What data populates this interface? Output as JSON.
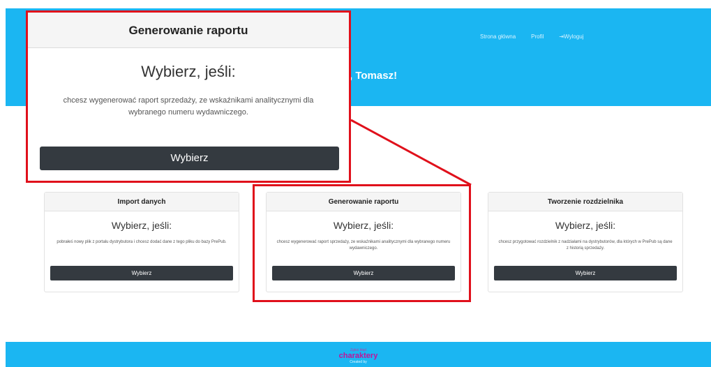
{
  "nav": {
    "home": "Strona główna",
    "profile": "Profil",
    "logout": "Wyloguj"
  },
  "greeting": ", Tomasz!",
  "cards": [
    {
      "title": "Import danych",
      "subtitle": "Wybierz, jeśli:",
      "text": "pobrałeś nowy plik z portalu dystrybutora i chcesz dodać dane z tego pliku do bazy PrePub.",
      "button": "Wybierz"
    },
    {
      "title": "Generowanie raportu",
      "subtitle": "Wybierz, jeśli:",
      "text": "chcesz wygenerować raport sprzedaży, ze wskaźnikami analitycznymi dla wybranego numeru wydawniczego.",
      "button": "Wybierz"
    },
    {
      "title": "Tworzenie rozdzielnika",
      "subtitle": "Wybierz, jeśli:",
      "text": "chcesz przygotować rozdzielnik z nadziałami na dystrybutorów, dla których w PrePub są dane z historią sprzedaży.",
      "button": "Wybierz"
    }
  ],
  "zoom": {
    "title": "Generowanie raportu",
    "subtitle": "Wybierz, jeśli:",
    "text": "chcesz wygenerować raport sprzedaży, ze wskaźnikami analitycznymi dla wybranego numeru wydawniczego.",
    "button": "Wybierz"
  },
  "footer": {
    "small_top": "Zgłoś błąd",
    "brand": "charaktery",
    "small_bottom": "Created by"
  },
  "colors": {
    "header": "#1bb6f2",
    "highlight": "#e0101b",
    "button": "#343a40"
  }
}
